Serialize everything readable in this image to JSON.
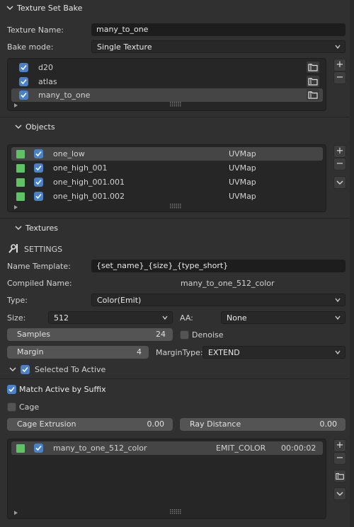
{
  "panel": {
    "title": "Texture Set Bake",
    "texture_name_label": "Texture Name:",
    "texture_name_value": "many_to_one",
    "bake_mode_label": "Bake mode:",
    "bake_mode_value": "Single Texture",
    "texture_sets": [
      {
        "name": "d20",
        "checked": true
      },
      {
        "name": "atlas",
        "checked": true
      },
      {
        "name": "many_to_one",
        "checked": true,
        "selected": true
      }
    ]
  },
  "objects": {
    "title": "Objects",
    "items": [
      {
        "name": "one_low",
        "uv": "UVMap",
        "selected": true
      },
      {
        "name": "one_high_001",
        "uv": "UVMap"
      },
      {
        "name": "one_high_001.001",
        "uv": "UVMap"
      },
      {
        "name": "one_high_001.002",
        "uv": "UVMap"
      }
    ]
  },
  "textures": {
    "title": "Textures",
    "settings_label": "SETTINGS",
    "name_template_label": "Name Template:",
    "name_template_value": "{set_name}_{size}_{type_short}",
    "compiled_name_label": "Compiled Name:",
    "compiled_name_value": "many_to_one_512_color",
    "type_label": "Type:",
    "type_value": "Color(Emit)",
    "size_label": "Size:",
    "size_value": "512",
    "aa_label": "AA:",
    "aa_value": "None",
    "samples_label": "Samples",
    "samples_value": "24",
    "denoise_label": "Denoise",
    "margin_label": "Margin",
    "margin_value": "4",
    "margin_type_label": "MarginType:",
    "margin_type_value": "EXTEND",
    "selected_to_active_label": "Selected To Active",
    "match_active_label": "Match Active by Suffix",
    "cage_label": "Cage",
    "cage_extrusion_label": "Cage Extrusion",
    "cage_extrusion_value": "0.00",
    "ray_distance_label": "Ray Distance",
    "ray_distance_value": "0.00",
    "bake_items": [
      {
        "name": "many_to_one_512_color",
        "type": "EMIT_COLOR",
        "time": "00:00:02"
      }
    ]
  },
  "icons": {
    "plus": "+",
    "minus": "−",
    "grip": "⠿⠿⠿"
  },
  "colors": {
    "accent": "#4a82c9",
    "object_green": "#5fc265"
  }
}
